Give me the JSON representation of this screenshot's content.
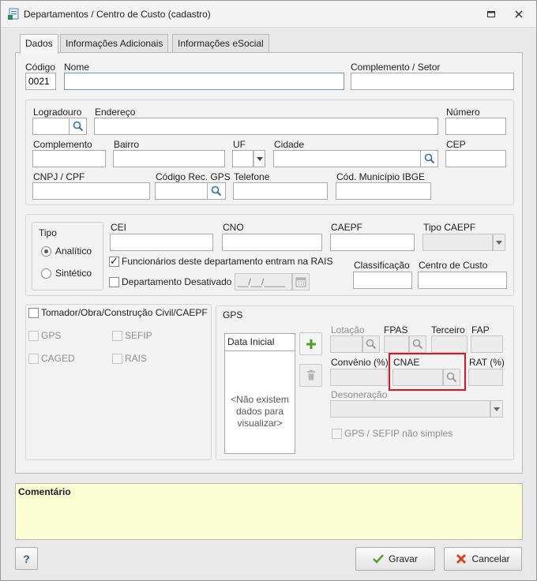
{
  "window": {
    "title": "Departamentos / Centro de Custo (cadastro)"
  },
  "tabs": [
    {
      "label": "Dados"
    },
    {
      "label": "Informações Adicionais"
    },
    {
      "label": "Informações eSocial"
    }
  ],
  "top": {
    "codigo_label": "Código",
    "codigo_value": "0021",
    "nome_label": "Nome",
    "nome_value": "",
    "complemento_setor_label": "Complemento / Setor",
    "complemento_setor_value": ""
  },
  "address": {
    "logradouro_label": "Logradouro",
    "endereco_label": "Endereço",
    "numero_label": "Número",
    "complemento_label": "Complemento",
    "bairro_label": "Bairro",
    "uf_label": "UF",
    "cidade_label": "Cidade",
    "cep_label": "CEP",
    "cnpj_label": "CNPJ / CPF",
    "codigo_rec_gps_label": "Código Rec. GPS",
    "telefone_label": "Telefone",
    "cod_municipio_label": "Cód. Município IBGE"
  },
  "tipo": {
    "legend": "Tipo",
    "options": [
      "Analítico",
      "Sintético"
    ],
    "selected": "Analítico"
  },
  "docs": {
    "cei_label": "CEI",
    "cno_label": "CNO",
    "caepf_label": "CAEPF",
    "tipo_caepf_label": "Tipo CAEPF",
    "funcionarios_rais_label": "Funcionários deste departamento entram na RAIS",
    "funcionarios_rais_checked": true,
    "depto_desativado_label": "Departamento Desativado",
    "depto_desativado_checked": false,
    "data_placeholder": "__/__/____",
    "classificacao_label": "Classificação",
    "centro_custo_label": "Centro de Custo"
  },
  "tomador": {
    "label": "Tomador/Obra/Construção Civil/CAEPF",
    "options": [
      {
        "label": "GPS"
      },
      {
        "label": "SEFIP"
      },
      {
        "label": "CAGED"
      },
      {
        "label": "RAIS"
      }
    ]
  },
  "gps": {
    "legend": "GPS",
    "list_header": "Data Inicial",
    "empty_message": "<Não existem\ndados para\nvisualizar>",
    "lotacao_label": "Lotação",
    "fpas_label": "FPAS",
    "terceiro_label": "Terceiro",
    "fap_label": "FAP",
    "convenio_label": "Convênio (%)",
    "cnae_label": "CNAE",
    "rat_label": "RAT (%)",
    "desoneracao_label": "Desoneração",
    "nao_simples_label": "GPS / SEFIP não simples"
  },
  "comment": {
    "label": "Comentário"
  },
  "footer": {
    "help_label": "?",
    "save_label": "Gravar",
    "cancel_label": "Cancelar"
  },
  "colors": {
    "window_bg": "#e9e9e9",
    "panel_bg": "#f3f3f3",
    "comment_bg": "#fcfed3",
    "highlight": "#e0141c",
    "save_icon": "#5aa12a",
    "cancel_icon": "#d9401f",
    "add_icon": "#4aa020"
  }
}
